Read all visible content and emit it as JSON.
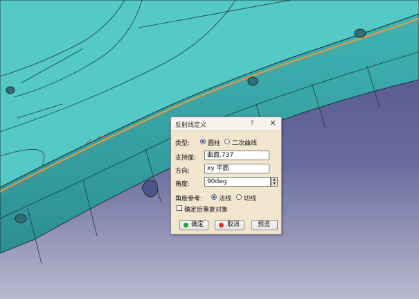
{
  "dialog": {
    "title": "反射线定义",
    "help": "?",
    "close": "✕",
    "type_label": "类型:",
    "type_options": [
      "圆柱",
      "二次曲线"
    ],
    "type_selected": "圆柱",
    "support_label": "支持面:",
    "support_value": "曲面.737",
    "direction_label": "方向:",
    "direction_value": "xy 平面",
    "angle_label": "角度:",
    "angle_value": "90deg",
    "angle_ref_label": "角度参考:",
    "angle_ref_options": [
      "法线",
      "切线"
    ],
    "angle_ref_selected": "法线",
    "checkbox_label": "确定后重复对象",
    "checkbox_checked": false,
    "ok_label": "确定",
    "cancel_label": "取消",
    "preview_label": "预览"
  },
  "colors": {
    "dialog_bg": "#f3e6cf",
    "part_surface": "#55c9c6",
    "background_top": "#4a4f86",
    "background_bottom": "#b9b9cf",
    "ok_icon": "#2e9e3a",
    "cancel_icon": "#d23a2a"
  }
}
